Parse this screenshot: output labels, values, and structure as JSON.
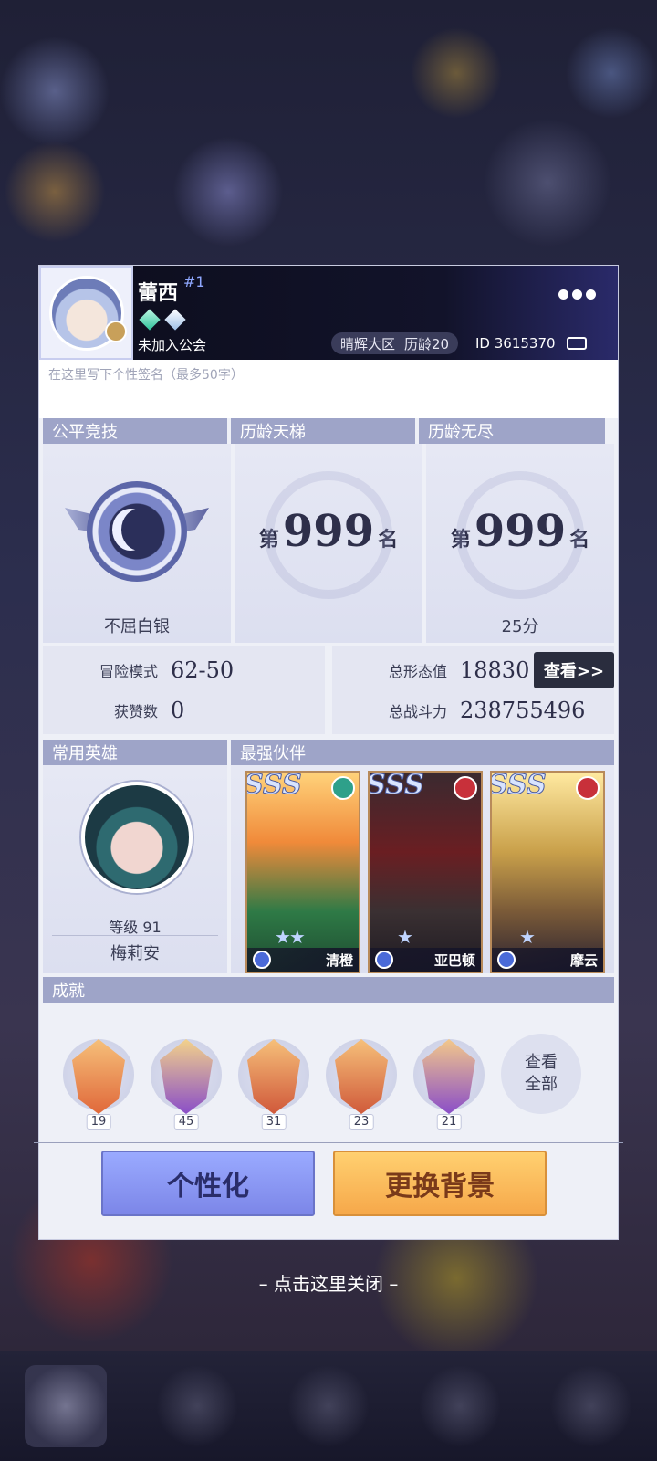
{
  "player": {
    "name": "蕾西",
    "rank_tag": "#1",
    "guild": "未加入公会",
    "server": "晴辉大区",
    "age": "历龄20",
    "id": "ID 3615370",
    "signature_placeholder": "在这里写下个性签名（最多50字）"
  },
  "ranks": {
    "headers": [
      "公平竞技",
      "历龄天梯",
      "历龄无尽"
    ],
    "arena_title": "不屈白银",
    "ladder": {
      "pre": "第",
      "num": "999",
      "post": "名"
    },
    "endless": {
      "pre": "第",
      "num": "999",
      "post": "名",
      "score": "25分"
    }
  },
  "stats": {
    "adventure_label": "冒险模式",
    "adventure_value": "62-50",
    "likes_label": "获赞数",
    "likes_value": "0",
    "form_label": "总形态值",
    "form_value": "18830",
    "power_label": "总战斗力",
    "power_value": "238755496",
    "view_button": "查看>>"
  },
  "heroes": {
    "fav_header": "常用英雄",
    "partners_header": "最强伙伴",
    "fav_level": "等级 91",
    "fav_name": "梅莉安",
    "partners": [
      {
        "rarity": "SSS",
        "name": "清橙",
        "element": "nature"
      },
      {
        "rarity": "SSS",
        "name": "亚巴顿",
        "element": "fire"
      },
      {
        "rarity": "SSS",
        "name": "摩云",
        "element": "fire"
      }
    ]
  },
  "achievements": {
    "header": "成就",
    "counts": [
      "19",
      "45",
      "31",
      "23",
      "21"
    ],
    "view_all_line1": "查看",
    "view_all_line2": "全部"
  },
  "actions": {
    "personalize": "个性化",
    "change_bg": "更换背景"
  },
  "close_hint": "– 点击这里关闭 –",
  "colors": {
    "header_bar": "#9ea4c8",
    "panel_bg": "#eef0f7",
    "personalize_btn": "#8c98f4",
    "bg_btn": "#fbbc5e"
  }
}
